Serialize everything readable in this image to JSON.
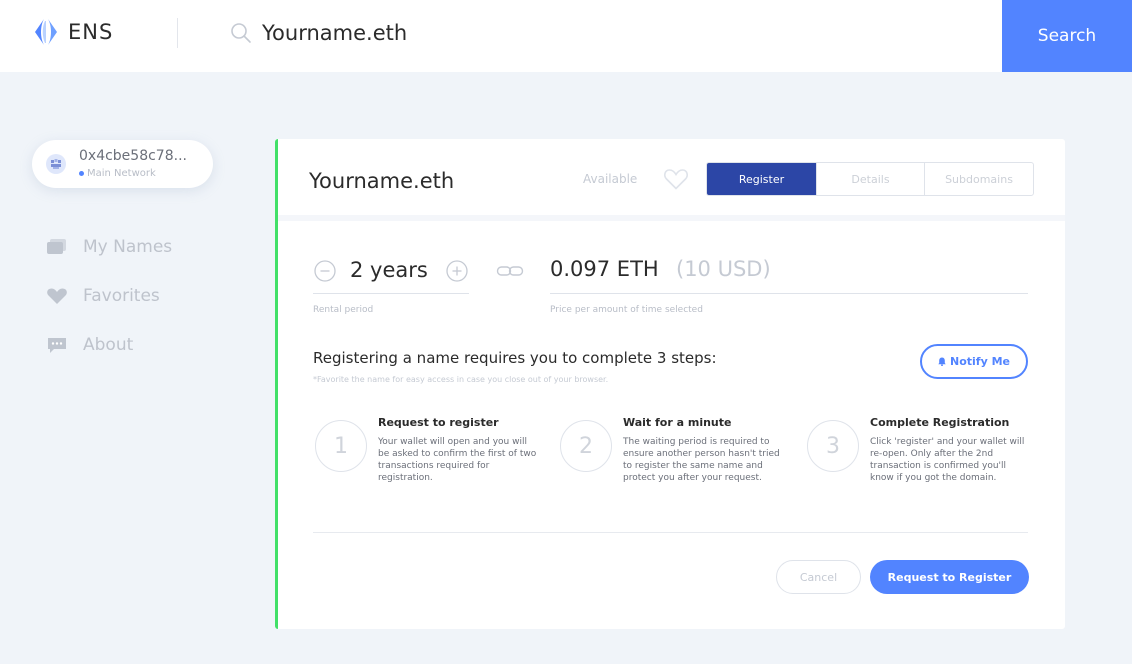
{
  "header": {
    "logo_text": "ENS",
    "search_value": "Yourname.eth",
    "search_button": "Search"
  },
  "sidebar": {
    "account": {
      "address": "0x4cbe58c78...",
      "network": "Main Network"
    },
    "items": [
      {
        "label": "My Names",
        "icon": "cards-icon"
      },
      {
        "label": "Favorites",
        "icon": "heart-icon"
      },
      {
        "label": "About",
        "icon": "speech-bubble-icon"
      }
    ]
  },
  "name_card": {
    "domain": "Yourname.eth",
    "status": "Available",
    "tabs": [
      {
        "label": "Register",
        "active": true
      },
      {
        "label": "Details",
        "active": false
      },
      {
        "label": "Subdomains",
        "active": false
      }
    ],
    "duration": "2 years",
    "duration_caption": "Rental period",
    "price_eth": "0.097 ETH",
    "price_usd": "(10 USD)",
    "price_caption": "Price per amount of time selected"
  },
  "steps_section": {
    "heading": "Registering a name requires you to complete 3 steps:",
    "note": "*Favorite the name for easy access in case you close out of your browser.",
    "notify_button": "Notify Me",
    "steps": [
      {
        "number": "1",
        "title": "Request to register",
        "description": "Your wallet will open and you will be asked to confirm the first of two transactions required for registration."
      },
      {
        "number": "2",
        "title": "Wait for a minute",
        "description": "The waiting period is required to ensure another person hasn't tried to register the same name and protect you after your request."
      },
      {
        "number": "3",
        "title": "Complete Registration",
        "description": "Click 'register' and your wallet will re-open. Only after the 2nd transaction is confirmed you'll know if you got the domain."
      }
    ],
    "cancel_button": "Cancel",
    "register_button": "Request to Register"
  },
  "colors": {
    "accent": "#5284ff",
    "active_tab": "#2c46a6",
    "available_border": "#42e068",
    "background": "#f0f4f9"
  }
}
